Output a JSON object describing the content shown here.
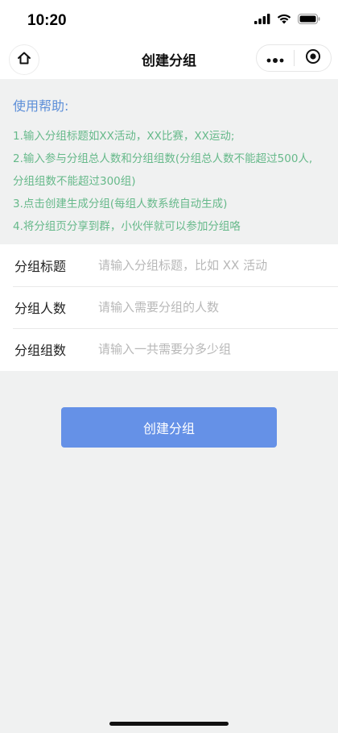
{
  "status_bar": {
    "time": "10:20"
  },
  "nav": {
    "title": "创建分组"
  },
  "help": {
    "title": "使用帮助:",
    "lines": [
      "1.输入分组标题如XX活动，XX比赛，XX运动;",
      "2.输入参与分组总人数和分组组数(分组总人数不能超过500人,",
      "分组组数不能超过300组)",
      "3.点击创建生成分组(每组人数系统自动生成)",
      "4.将分组页分享到群，小伙伴就可以参加分组咯"
    ]
  },
  "form": {
    "title": {
      "label": "分组标题",
      "placeholder": "请输入分组标题，比如 XX 活动"
    },
    "people": {
      "label": "分组人数",
      "placeholder": "请输入需要分组的人数"
    },
    "groups": {
      "label": "分组组数",
      "placeholder": "请输入一共需要分多少组"
    }
  },
  "actions": {
    "create_label": "创建分组"
  },
  "colors": {
    "accent": "#6591e7",
    "help_title": "#5d8fd8",
    "help_text": "#66b98a"
  },
  "icons": [
    "signal-icon",
    "wifi-icon",
    "battery-icon",
    "home-icon",
    "more-icon",
    "close-mini-icon"
  ]
}
